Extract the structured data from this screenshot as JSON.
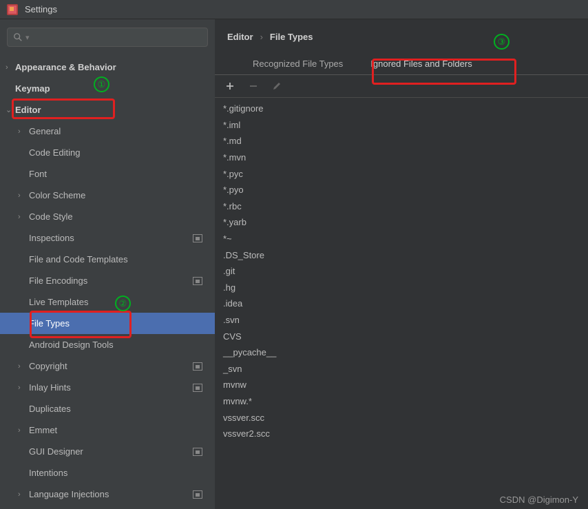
{
  "window": {
    "title": "Settings"
  },
  "search": {
    "placeholder": ""
  },
  "sidebar": {
    "items": [
      {
        "label": "Appearance & Behavior",
        "level": 0,
        "chev": "›",
        "bold": true
      },
      {
        "label": "Keymap",
        "level": 0,
        "chev": "",
        "bold": true
      },
      {
        "label": "Editor",
        "level": 0,
        "chev": "⌄",
        "bold": true
      },
      {
        "label": "General",
        "level": 1,
        "chev": "›",
        "bold": false
      },
      {
        "label": "Code Editing",
        "level": 1,
        "chev": "",
        "bold": false
      },
      {
        "label": "Font",
        "level": 1,
        "chev": "",
        "bold": false
      },
      {
        "label": "Color Scheme",
        "level": 1,
        "chev": "›",
        "bold": false
      },
      {
        "label": "Code Style",
        "level": 1,
        "chev": "›",
        "bold": false
      },
      {
        "label": "Inspections",
        "level": 1,
        "chev": "",
        "bold": false,
        "badge": true
      },
      {
        "label": "File and Code Templates",
        "level": 1,
        "chev": "",
        "bold": false
      },
      {
        "label": "File Encodings",
        "level": 1,
        "chev": "",
        "bold": false,
        "badge": true
      },
      {
        "label": "Live Templates",
        "level": 1,
        "chev": "",
        "bold": false
      },
      {
        "label": "File Types",
        "level": 1,
        "chev": "",
        "bold": false,
        "selected": true
      },
      {
        "label": "Android Design Tools",
        "level": 1,
        "chev": "",
        "bold": false
      },
      {
        "label": "Copyright",
        "level": 1,
        "chev": "›",
        "bold": false,
        "badge": true
      },
      {
        "label": "Inlay Hints",
        "level": 1,
        "chev": "›",
        "bold": false,
        "badge": true
      },
      {
        "label": "Duplicates",
        "level": 1,
        "chev": "",
        "bold": false
      },
      {
        "label": "Emmet",
        "level": 1,
        "chev": "›",
        "bold": false
      },
      {
        "label": "GUI Designer",
        "level": 1,
        "chev": "",
        "bold": false,
        "badge": true
      },
      {
        "label": "Intentions",
        "level": 1,
        "chev": "",
        "bold": false
      },
      {
        "label": "Language Injections",
        "level": 1,
        "chev": "›",
        "bold": false,
        "badge": true
      }
    ]
  },
  "breadcrumb": {
    "parent": "Editor",
    "current": "File Types"
  },
  "tabs": {
    "t0": "Recognized File Types",
    "t1": "Ignored Files and Folders"
  },
  "patterns": [
    "*.gitignore",
    "*.iml",
    "*.md",
    "*.mvn",
    "*.pyc",
    "*.pyo",
    "*.rbc",
    "*.yarb",
    "*~",
    ".DS_Store",
    ".git",
    ".hg",
    ".idea",
    ".svn",
    "CVS",
    "__pycache__",
    "_svn",
    "mvnw",
    "mvnw.*",
    "vssver.scc",
    "vssver2.scc"
  ],
  "annotations": {
    "one": "①",
    "two": "②",
    "three": "③"
  },
  "watermark": "CSDN @Digimon-Y"
}
